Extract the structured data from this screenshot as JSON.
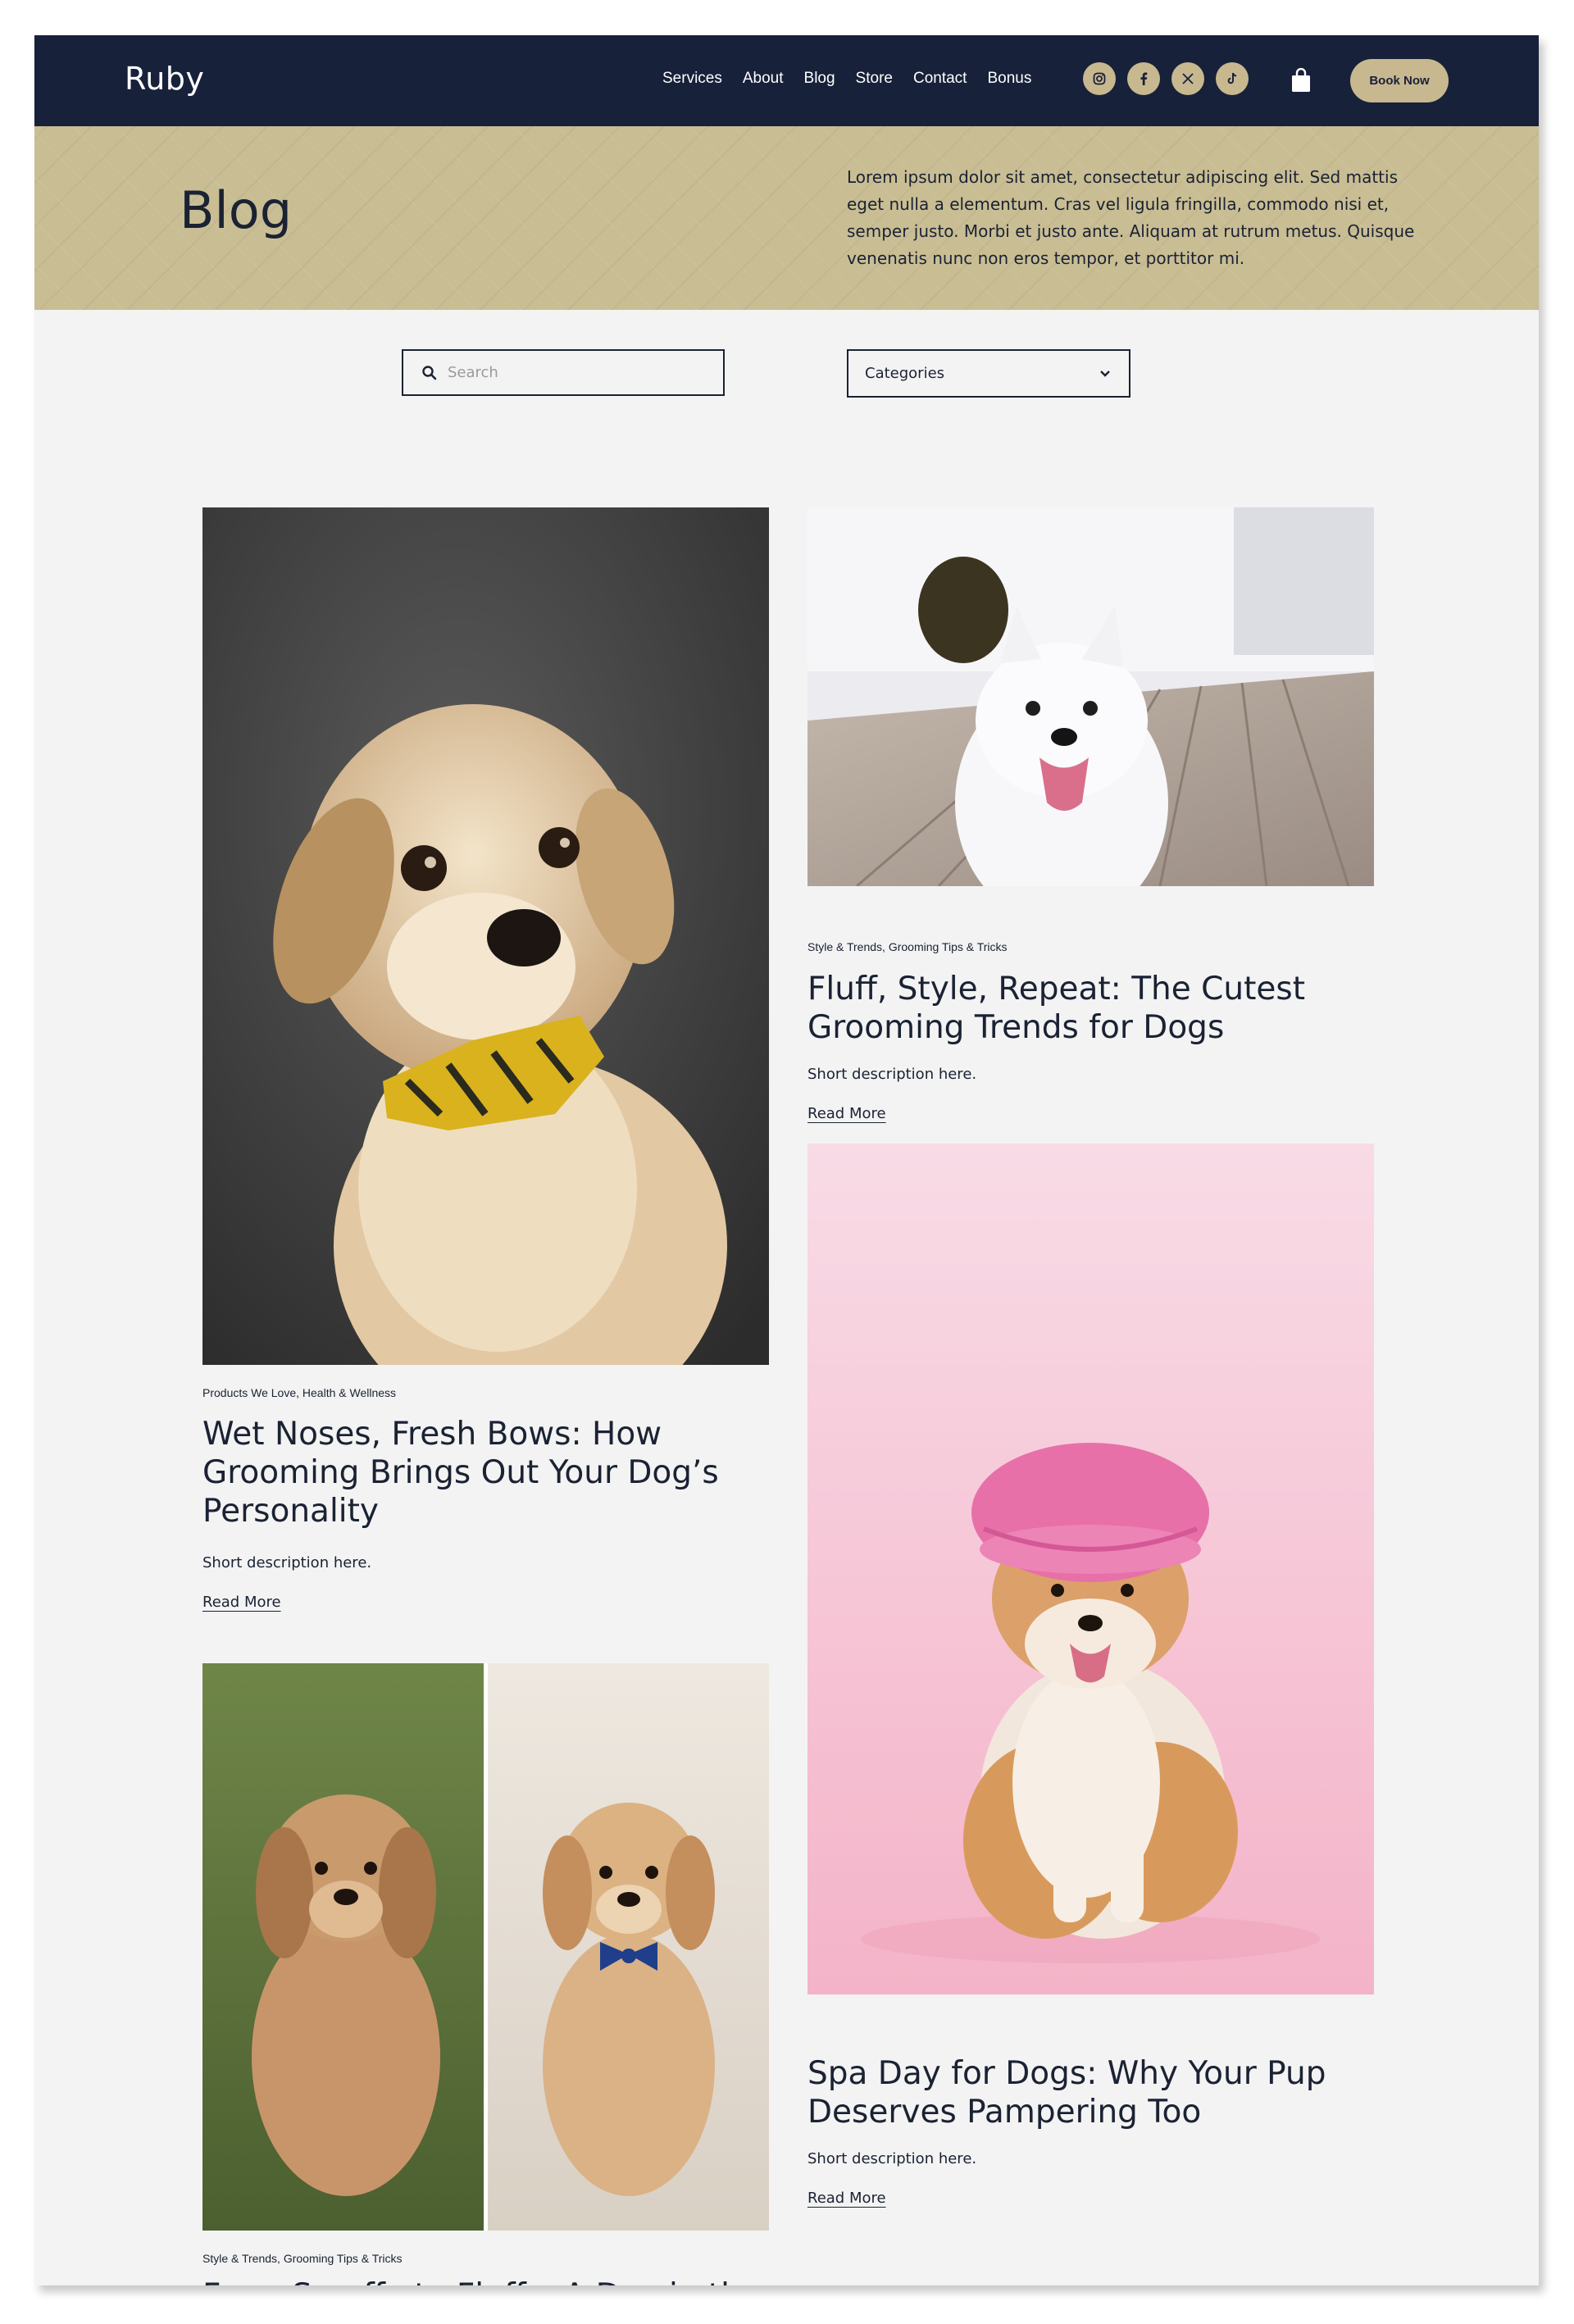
{
  "header": {
    "logo": "Ruby",
    "nav": [
      "Services",
      "About",
      "Blog",
      "Store",
      "Contact",
      "Bonus"
    ],
    "socials": [
      "instagram-icon",
      "facebook-icon",
      "x-icon",
      "tiktok-icon"
    ],
    "cart_icon": "shopping-bag-icon",
    "cta": "Book Now"
  },
  "hero": {
    "title": "Blog",
    "text": "Lorem ipsum dolor sit amet, consectetur adipiscing elit. Sed mattis eget nulla a elementum. Cras vel ligula fringilla, commodo nisi et, semper justo. Morbi et justo ante. Aliquam at rutrum metus. Quisque venenatis nunc non eros tempor, et porttitor mi."
  },
  "filters": {
    "search_placeholder": "Search",
    "categories_label": "Categories"
  },
  "posts": [
    {
      "image": "dog with yellow plaid bow tie",
      "categories": "Products We Love, Health & Wellness",
      "title": "Wet Noses, Fresh Bows: How Grooming Brings Out Your Dog’s Personality",
      "description": "Short description here.",
      "link": "Read More"
    },
    {
      "image": "white samoyed on wooden deck",
      "categories": "Style & Trends, Grooming Tips & Tricks",
      "title": "Fluff, Style, Repeat: The Cutest Grooming Trends for Dogs",
      "description": "Short description here.",
      "link": "Read More"
    },
    {
      "image": "shiba inu wearing pink shower cap",
      "categories": "",
      "title": "Spa Day for Dogs: Why Your Pup Deserves Pampering Too",
      "description": "Short description here.",
      "link": "Read More"
    },
    {
      "image": "puppy before and after grooming",
      "categories": "Style & Trends, Grooming Tips & Tricks",
      "title": "From Scruffy to Fluffy: A Day in the",
      "description": "",
      "link": ""
    }
  ],
  "colors": {
    "navy": "#18213a",
    "gold": "#c8b88f",
    "page": "#f3f3f3"
  }
}
